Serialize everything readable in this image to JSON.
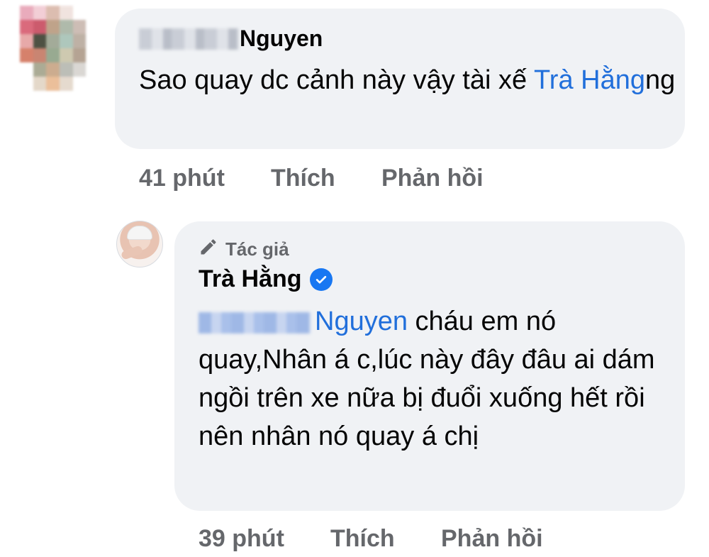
{
  "comment1": {
    "author_name": "Nguyen",
    "text_before": "Sao quay dc cảnh này vậy tài xế ",
    "mention": "Trà Hằng",
    "text_after": "ng",
    "time": "41 phút",
    "like_label": "Thích",
    "reply_label": "Phản hồi"
  },
  "reply1": {
    "badge_label": "Tác giả",
    "author_name": "Trà Hằng",
    "mention": "Nguyen",
    "text": " cháu em nó quay,Nhân á c,lúc này đây đâu ai dám ngồi trên xe nữa bị đuổi xuống hết rồi nên nhân nó quay á chị",
    "time": "39 phút",
    "like_label": "Thích",
    "reply_label": "Phản hồi"
  },
  "colors": {
    "bubble": "#f0f2f5",
    "link": "#216fdb",
    "meta": "#65676b",
    "verified": "#1877f2"
  },
  "icons": {
    "badge": "pencil-icon",
    "verified": "verified-check-icon"
  }
}
